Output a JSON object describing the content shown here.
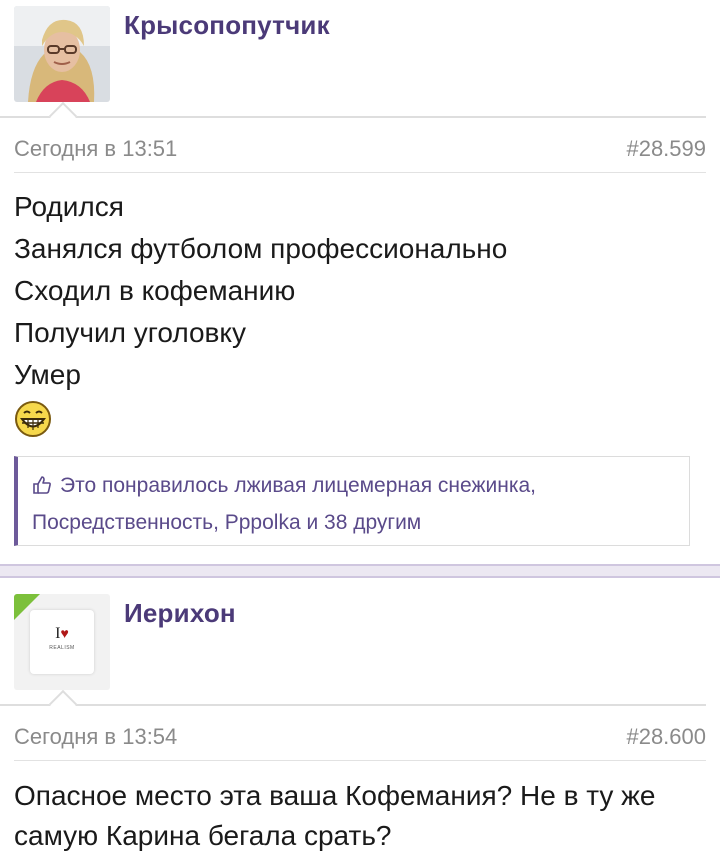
{
  "posts": [
    {
      "username": "Крысопопутчик",
      "date": "Сегодня в 13:51",
      "number": "#28.599",
      "lines": [
        "Родился",
        "Занялся футболом профессионально",
        "Сходил в кофеманию",
        "Получил уголовку",
        "Умер"
      ],
      "emoji": "grinning-face-icon",
      "likes": {
        "text_line1": "Это понравилось лживая лицемерная снежинка,",
        "text_line2": "Посредственность, Pppolka и 38 другим"
      }
    },
    {
      "username": "Иерихон",
      "avatar_text": "I",
      "avatar_subtext": "REALISM",
      "date": "Сегодня в 13:54",
      "number": "#28.600",
      "lines": [
        "Опасное место эта ваша Кофемания? Не в ту же",
        "самую Карина бегала срать?"
      ]
    }
  ],
  "colors": {
    "username": "#4b3a78",
    "accent_bar": "#6d5a9a",
    "new_badge": "#7cc03b"
  }
}
